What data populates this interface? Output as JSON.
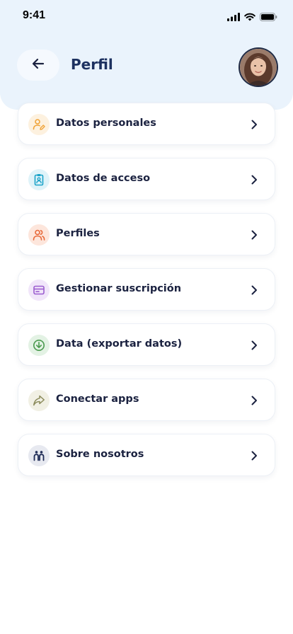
{
  "status_bar": {
    "time": "9:41"
  },
  "header": {
    "title": "Perfil"
  },
  "menu": {
    "items": [
      {
        "label": "Datos personales",
        "icon": "user-edit-icon",
        "icon_color": "#f0a43a",
        "icon_bg": "#fdf1df"
      },
      {
        "label": "Datos de acceso",
        "icon": "clipboard-user-icon",
        "icon_color": "#1aa3c9",
        "icon_bg": "#dff3f9"
      },
      {
        "label": "Perfiles",
        "icon": "users-icon",
        "icon_color": "#e8693a",
        "icon_bg": "#fde6dc"
      },
      {
        "label": "Gestionar suscripción",
        "icon": "wallet-icon",
        "icon_color": "#9b5ccf",
        "icon_bg": "#f1e6fa"
      },
      {
        "label": "Data (exportar datos)",
        "icon": "download-circle-icon",
        "icon_color": "#4a9a4e",
        "icon_bg": "#e3f2e4"
      },
      {
        "label": "Conectar apps",
        "icon": "share-arrow-icon",
        "icon_color": "#8a8a5a",
        "icon_bg": "#f1f0e4"
      },
      {
        "label": "Sobre nosotros",
        "icon": "team-icon",
        "icon_color": "#1d2a55",
        "icon_bg": "#e7e9f0"
      }
    ]
  }
}
